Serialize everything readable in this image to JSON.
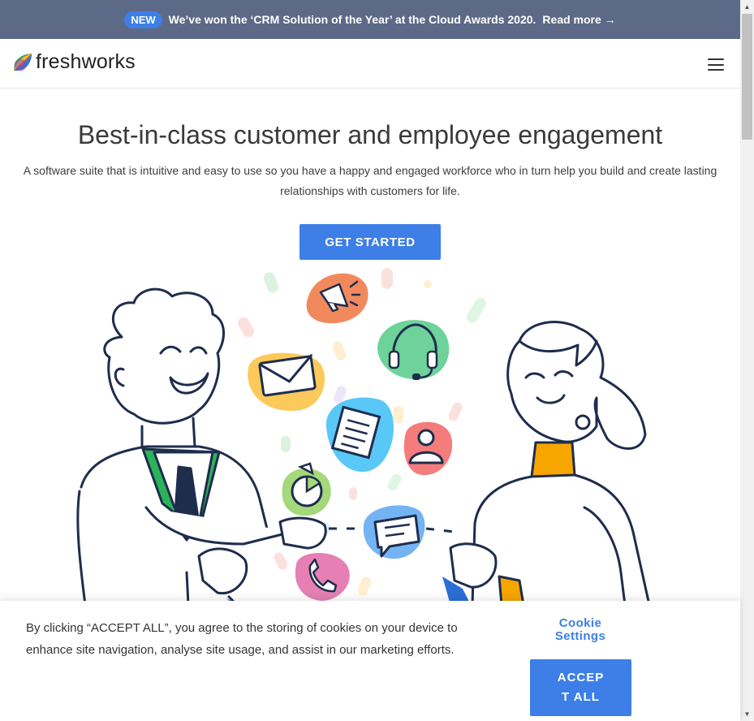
{
  "announcement": {
    "badge": "NEW",
    "text": "We’ve won the ‘CRM Solution of the Year’ at the Cloud Awards 2020.",
    "link": "Read more →"
  },
  "header": {
    "logo_text": "freshworks",
    "menu_icon": "hamburger-menu-icon"
  },
  "hero": {
    "title": "Best-in-class customer and employee engagement",
    "subtitle": "A software suite that is intuitive and easy to use so you have a happy and engaged workforce who in turn help you build and create lasting relationships with customers for life.",
    "cta_label": "GET STARTED"
  },
  "illustration": {
    "icons": [
      "megaphone-icon",
      "headset-icon",
      "envelope-icon",
      "document-icon",
      "user-icon",
      "pie-chart-icon",
      "chat-icon",
      "phone-icon"
    ]
  },
  "cookie_banner": {
    "text": "By clicking “ACCEPT ALL”, you agree to the storing of cookies on your device to enhance site navigation, analyse site usage, and assist in our marketing efforts.",
    "settings_label": "Cookie Settings",
    "accept_label": "ACCEPT ALL"
  },
  "colors": {
    "brand_blue": "#3d7fe6",
    "announce_bg": "#5d6a87",
    "ink": "#1f2d4d"
  }
}
